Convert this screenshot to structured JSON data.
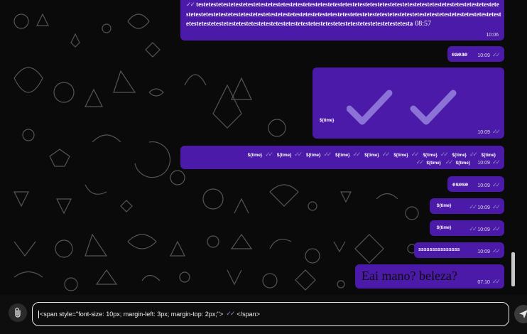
{
  "chat": {
    "wallpaper_icon": "doodle-pattern",
    "bubble_color": "#4c1aa8",
    "tick_color": "#8f86c9",
    "messages": [
      {
        "text": "testetestetestetestetestetestetestetestetestetestetestetestetestetestetestetestetestetestetestetestetestetestetestetestetestetestetestetestetestetestetestetestetestetestetestetestetestetestetestetestetestetestetestetestetestetestetestetestetestetestetestetestetestetestetestetestetestetestetestetestetestetestetestetestetestetestetestetesta",
        "inline_time": "08:57",
        "time": "10:06"
      },
      {
        "text": "eaeae",
        "time": "10:09"
      },
      {
        "text": "${time}",
        "time": "10:09",
        "big_ticks_icon": "double-check-icon"
      },
      {
        "text_row1": [
          "${time}",
          "${time}",
          "${time}",
          "${time}",
          "${time}",
          "${time}",
          "${time}",
          "${time}",
          "${time}"
        ],
        "text_row2": [
          "${time}",
          "${time}"
        ],
        "time": "10:09"
      },
      {
        "text": "esese",
        "time": "10:09"
      },
      {
        "text": "${time}",
        "time": "10:09"
      },
      {
        "text": "${time}",
        "time": "10:09"
      },
      {
        "text": "sssssssssssssss",
        "time": "10:09"
      },
      {
        "text": "Eai mano? beleza?",
        "time": "07:10"
      }
    ]
  },
  "composer": {
    "attach_icon": "paperclip-icon",
    "value_before": "<span style=\"font-size: 10px; margin-left: 3px; margin-top: 2px;\">",
    "value_after": "</span>",
    "send_icon": "send-icon"
  }
}
